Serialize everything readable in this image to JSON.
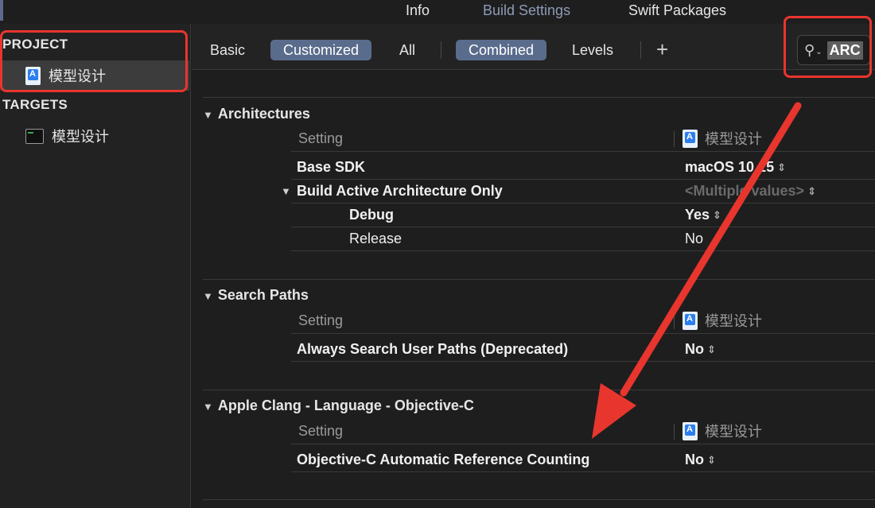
{
  "top_tabs": [
    "Info",
    "Build Settings",
    "Swift Packages"
  ],
  "sidebar": {
    "project_header": "PROJECT",
    "project_item": "模型设计",
    "targets_header": "TARGETS",
    "target_item": "模型设计"
  },
  "filter": {
    "scope": [
      "Basic",
      "Customized",
      "All"
    ],
    "view": [
      "Combined",
      "Levels"
    ],
    "add_label": "+",
    "search_value": "ARC"
  },
  "column_header": {
    "setting": "Setting",
    "project": "模型设计"
  },
  "sections": {
    "architectures": {
      "title": "Architectures",
      "base_sdk": {
        "name": "Base SDK",
        "value": "macOS 10.15"
      },
      "build_active": {
        "name": "Build Active Architecture Only",
        "value": "<Multiple values>"
      },
      "debug": {
        "name": "Debug",
        "value": "Yes"
      },
      "release": {
        "name": "Release",
        "value": "No"
      }
    },
    "search_paths": {
      "title": "Search Paths",
      "always_search": {
        "name": "Always Search User Paths (Deprecated)",
        "value": "No"
      }
    },
    "clang_objc": {
      "title": "Apple Clang - Language - Objective-C",
      "arc": {
        "name": "Objective-C Automatic Reference Counting",
        "value": "No"
      }
    }
  },
  "annotation_color": "#e8352e",
  "stepper_glyph": "◇"
}
